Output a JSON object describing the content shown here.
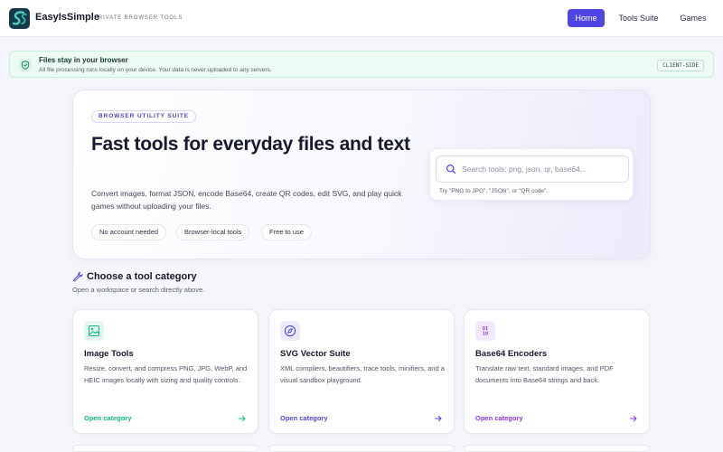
{
  "header": {
    "brand_name": "EasyIsSimple",
    "brand_tagline": "PRIVATE BROWSER TOOLS",
    "nav": [
      {
        "label": "Home",
        "active": true
      },
      {
        "label": "Tools Suite",
        "active": false
      },
      {
        "label": "Games",
        "active": false
      }
    ],
    "accent_color": "#4f46e5"
  },
  "banner": {
    "title": "Files stay in your browser",
    "text": "All file processing runs locally on your device. Your data is never uploaded to any servers.",
    "badge": "CLIENT-SIDE",
    "icon": "shield-check-icon"
  },
  "hero": {
    "chip": "BROWSER UTILITY SUITE",
    "title": "Fast tools for everyday files and text",
    "description": "Convert images, format JSON, encode Base64, create QR codes, edit SVG, and play quick games without uploading your files.",
    "pills": [
      "No account needed",
      "Browser-local tools",
      "Free to use"
    ],
    "search": {
      "placeholder": "Search tools: png, json, qr, base64...",
      "value": "",
      "hint": "Try \"PNG to JPG\", \"JSON\", or \"QR code\"."
    }
  },
  "section": {
    "title": "Choose a tool category",
    "subtitle": "Open a workspace or search directly above.",
    "icon": "wrench-icon"
  },
  "cards": [
    {
      "title": "Image Tools",
      "description": "Resize, convert, and compress PNG, JPG, WebP, and HEIC images locally with sizing and quality controls.",
      "link": "Open category",
      "icon": "image-icon",
      "color": "#10b981",
      "icon_bg": "#e3f7ee"
    },
    {
      "title": "SVG Vector Suite",
      "description": "XML compilers, beautifiers, trace tools, minifiers, and a visual sandbox playground.",
      "link": "Open category",
      "icon": "compass-icon",
      "color": "#4f46e5",
      "icon_bg": "#ecebfc"
    },
    {
      "title": "Base64 Encoders",
      "description": "Translate raw text, standard images, and PDF documents into Base64 strings and back.",
      "link": "Open category",
      "icon": "binary-icon",
      "icon_text": "01\n10",
      "color": "#9333ea",
      "icon_bg": "#f3e8fd"
    }
  ]
}
